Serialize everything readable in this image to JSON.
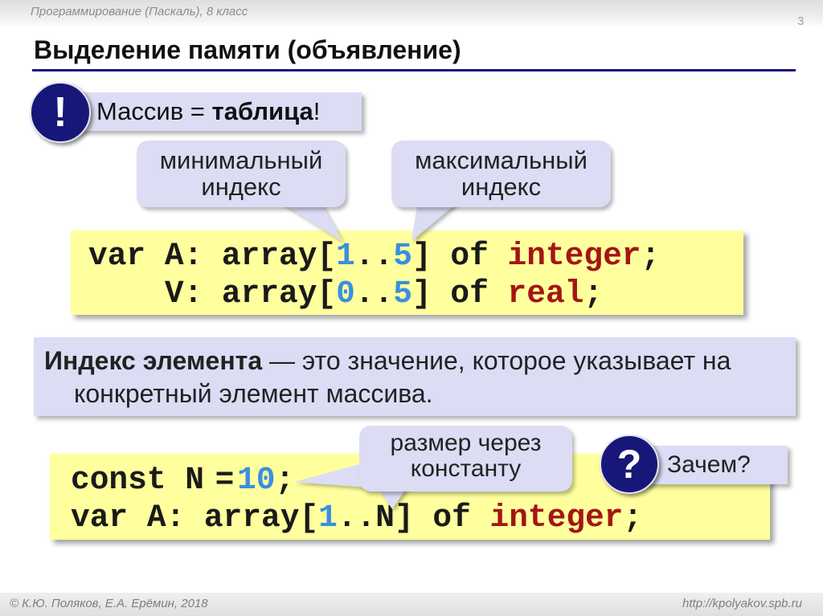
{
  "colors": {
    "accent_navy": "#17177a",
    "callout_fill": "#dcdcf5",
    "code_background": "#ffff9e",
    "number_literal": "#3a8fe0",
    "type_keyword": "#a31515",
    "muted_text": "#8c8c8c"
  },
  "header": {
    "course": "Программирование (Паскаль), 8 класс",
    "page_number": "3"
  },
  "title": "Выделение памяти (объявление)",
  "note": {
    "icon": "exclamation-icon",
    "glyph": "!",
    "text_before": "Массив = ",
    "text_bold": "таблица",
    "text_after": "!"
  },
  "callouts": {
    "min_index": {
      "line1": "минимальный",
      "line2": "индекс"
    },
    "max_index": {
      "line1": "максимальный",
      "line2": "индекс"
    },
    "size_via_constant": {
      "line1": "размер через",
      "line2": "константу"
    }
  },
  "code_block_1": {
    "lines": [
      [
        "var A: array[",
        "1",
        "..",
        "5",
        "] of ",
        "integer",
        ";"
      ],
      [
        "    V: array[",
        "0",
        "..",
        "5",
        "] of ",
        "real",
        ";"
      ]
    ]
  },
  "definition": {
    "term": "Индекс элемента",
    "text": " — это значение, которое указывает на конкретный элемент массива."
  },
  "code_block_2": {
    "lines": [
      [
        "const N",
        " = ",
        "10",
        ";"
      ],
      [
        "var A: array[",
        "1",
        "..N] of ",
        "integer",
        ";"
      ]
    ]
  },
  "question": {
    "icon": "question-icon",
    "glyph": "?",
    "text": "Зачем?"
  },
  "footer": {
    "copyright": "© К.Ю. Поляков, Е.А. Ерёмин, 2018",
    "url": "http://kpolyakov.spb.ru"
  }
}
